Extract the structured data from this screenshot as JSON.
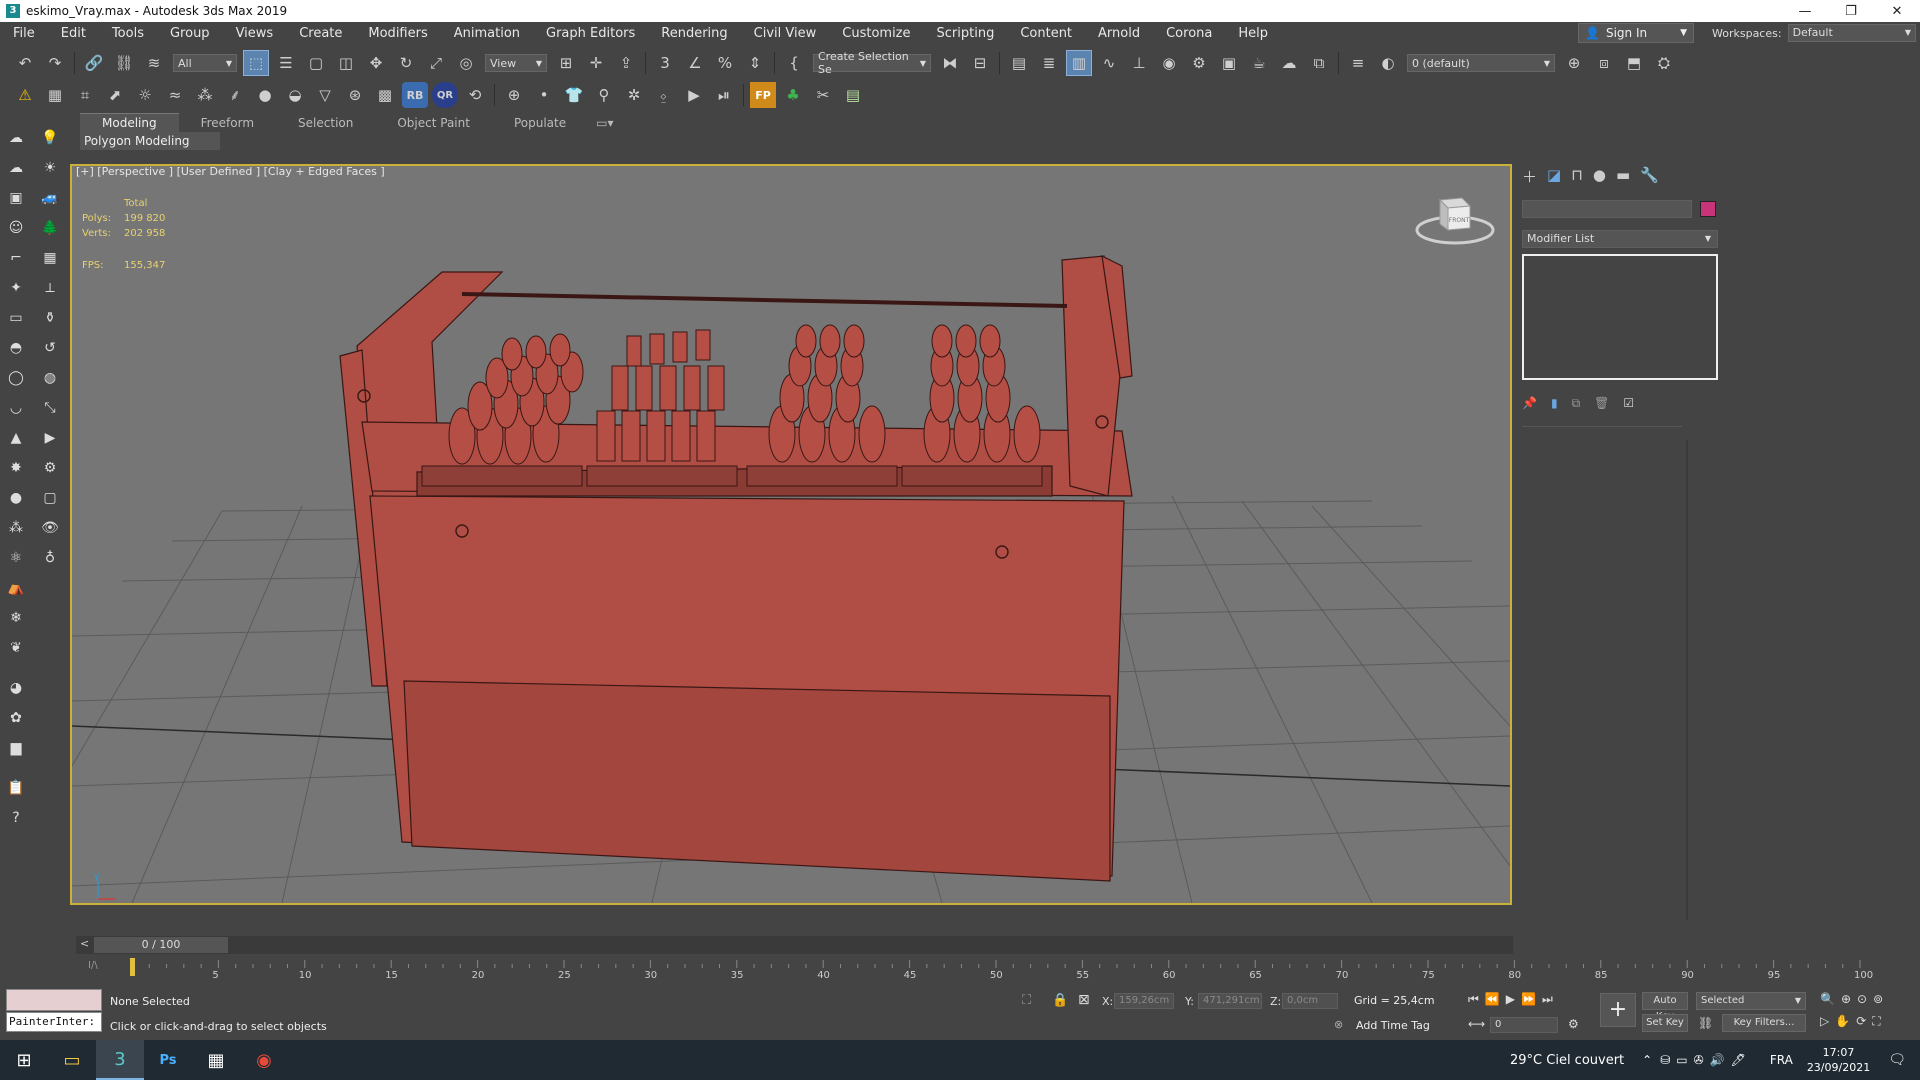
{
  "window": {
    "title": "eskimo_Vray.max - Autodesk 3ds Max 2019",
    "app_icon_label": "3"
  },
  "menu": [
    "File",
    "Edit",
    "Tools",
    "Group",
    "Views",
    "Create",
    "Modifiers",
    "Animation",
    "Graph Editors",
    "Rendering",
    "Civil View",
    "Customize",
    "Scripting",
    "Content",
    "Arnold",
    "Corona",
    "Help"
  ],
  "account": {
    "sign_in": "Sign In",
    "workspaces_label": "Workspaces:",
    "workspace": "Default"
  },
  "toolbar": {
    "selection_filter": "All",
    "ref_coord": "View",
    "named_selection": "Create Selection Se",
    "layer": "0 (default)",
    "badge_rb": "RB",
    "badge_qr": "QR",
    "badge_fp": "FP"
  },
  "ribbon": {
    "tabs": [
      "Modeling",
      "Freeform",
      "Selection",
      "Object Paint",
      "Populate"
    ],
    "active_tab": "Modeling",
    "panel": "Polygon Modeling"
  },
  "viewport": {
    "label": "[+] [Perspective ] [User Defined ] [Clay + Edged Faces ]",
    "stats_total": "Total",
    "polys_label": "Polys:",
    "polys": "199 820",
    "verts_label": "Verts:",
    "verts": "202 958",
    "fps_label": "FPS:",
    "fps": "155,347",
    "viewcube_face": "FRONT",
    "object_color": "#b04e45",
    "grid_color": "#5b5b5b",
    "bg_color": "#767676"
  },
  "timeline": {
    "frame": "0 / 100",
    "ticks": [
      "5",
      "10",
      "15",
      "20",
      "25",
      "30",
      "35",
      "40",
      "45",
      "50",
      "55",
      "60",
      "65",
      "70",
      "75",
      "80",
      "85",
      "90",
      "95",
      "100"
    ]
  },
  "status": {
    "selection": "None Selected",
    "prompt": "Click or click-and-drag to select objects",
    "script_listener": "PainterInter:",
    "x_label": "X:",
    "x": "159,26cm",
    "y_label": "Y:",
    "y": "471,291cm",
    "z_label": "Z:",
    "z": "0,0cm",
    "grid": "Grid = 25,4cm",
    "add_time_tag": "Add Time Tag",
    "auto_key": "Auto Key",
    "set_key": "Set Key",
    "key_mode": "Selected",
    "key_filters": "Key Filters...",
    "frame_field": "0"
  },
  "command_panel": {
    "modifier_list": "Modifier List",
    "object_color": "#c8347a"
  },
  "taskbar": {
    "weather": "29°C  Ciel couvert",
    "lang": "FRA",
    "time": "17:07",
    "date": "23/09/2021"
  }
}
